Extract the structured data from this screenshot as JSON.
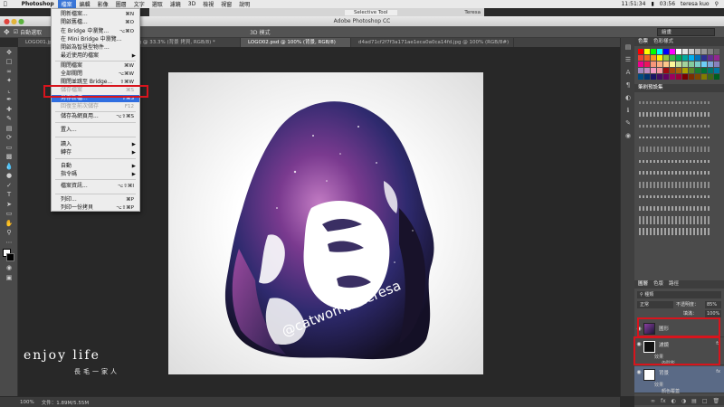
{
  "menubar": {
    "app": "Photoshop",
    "items": [
      "檔案",
      "編輯",
      "影像",
      "圖層",
      "文字",
      "選取",
      "濾鏡",
      "3D",
      "檢視",
      "視窗",
      "說明"
    ],
    "time": "11:51:34",
    "battery": "03:56",
    "user": "teresa kuo"
  },
  "chrome": {
    "tab": "Selective Tool",
    "teresa": "Teresa"
  },
  "window": {
    "title": "Adobe Photoshop CC"
  },
  "options": {
    "auto_select": "自動選取",
    "workspace": "繪畫",
    "mode_3d": "3D 模式"
  },
  "doc_tabs": [
    "LOGO01.jpg",
    "20150227_110445_1.jpg @ 33.3% (背景 拷貝, RGB/8) *",
    "LOGO02.psd @ 100% (背景, RGB/8)",
    "d4ad71cf2f7f3a171ae1eca0a0ca14fd.jpg @ 100% (RGB/8#)"
  ],
  "file_menu": [
    {
      "label": "開新檔案...",
      "shortcut": "⌘N"
    },
    {
      "label": "開啟舊檔...",
      "shortcut": "⌘O"
    },
    {
      "label": "在 Bridge 中瀏覽...",
      "shortcut": "⌥⌘O"
    },
    {
      "label": "在 Mini Bridge 中瀏覽...",
      "shortcut": ""
    },
    {
      "label": "開啟為智慧型物件...",
      "shortcut": ""
    },
    {
      "label": "最近使用的檔案",
      "shortcut": "",
      "submenu": true
    },
    {
      "label": "關閉檔案",
      "shortcut": "⌘W"
    },
    {
      "label": "全部關閉",
      "shortcut": "⌥⌘W"
    },
    {
      "label": "關閉並跳至 Bridge...",
      "shortcut": "⇧⌘W"
    },
    {
      "label": "儲存檔案",
      "shortcut": "⌘S",
      "disabled": true
    },
    {
      "label": "另存新檔...",
      "shortcut": "⇧⌘S",
      "highlighted": true
    },
    {
      "label": "回復至前次儲存",
      "shortcut": "F12",
      "disabled": true
    },
    {
      "label": "儲存為網頁用...",
      "shortcut": "⌥⇧⌘S"
    },
    {
      "label": "置入...",
      "shortcut": ""
    },
    {
      "label": "讀入",
      "shortcut": "",
      "submenu": true
    },
    {
      "label": "轉存",
      "shortcut": "",
      "submenu": true
    },
    {
      "label": "自動",
      "shortcut": "",
      "submenu": true
    },
    {
      "label": "指令碼",
      "shortcut": "",
      "submenu": true
    },
    {
      "label": "檔案資訊...",
      "shortcut": "⌥⇧⌘I"
    },
    {
      "label": "列印...",
      "shortcut": "⌘P"
    },
    {
      "label": "列印一份拷貝",
      "shortcut": "⌥⇧⌘P"
    }
  ],
  "canvas": {
    "signature": "@catwomanteresa"
  },
  "watermark": {
    "main": "enjoy life",
    "sub": "長毛一家人"
  },
  "status": {
    "zoom": "100%",
    "doc": "文件：1.89M/5.55M"
  },
  "panels": {
    "swatch_tabs": [
      "色票",
      "色彩樣式"
    ],
    "brush_tab": "筆刷預設集",
    "layer_tabs": [
      "圖層",
      "色版",
      "路徑"
    ],
    "blend_mode": "正常",
    "opacity_label": "不透明度：",
    "opacity": "85%",
    "fill_label": "填滿：",
    "fill": "100%",
    "layers": [
      {
        "name": "圖形",
        "selected": false
      },
      {
        "name": "濾鏡",
        "selected": false,
        "effects": [
          "效果",
          "內陰影"
        ]
      },
      {
        "name": "背景",
        "selected": true,
        "effects": [
          "效果",
          "顏色覆蓋"
        ]
      }
    ]
  },
  "colors": {
    "highlight": "#2f6ee0",
    "annotation": "#d8141d"
  }
}
